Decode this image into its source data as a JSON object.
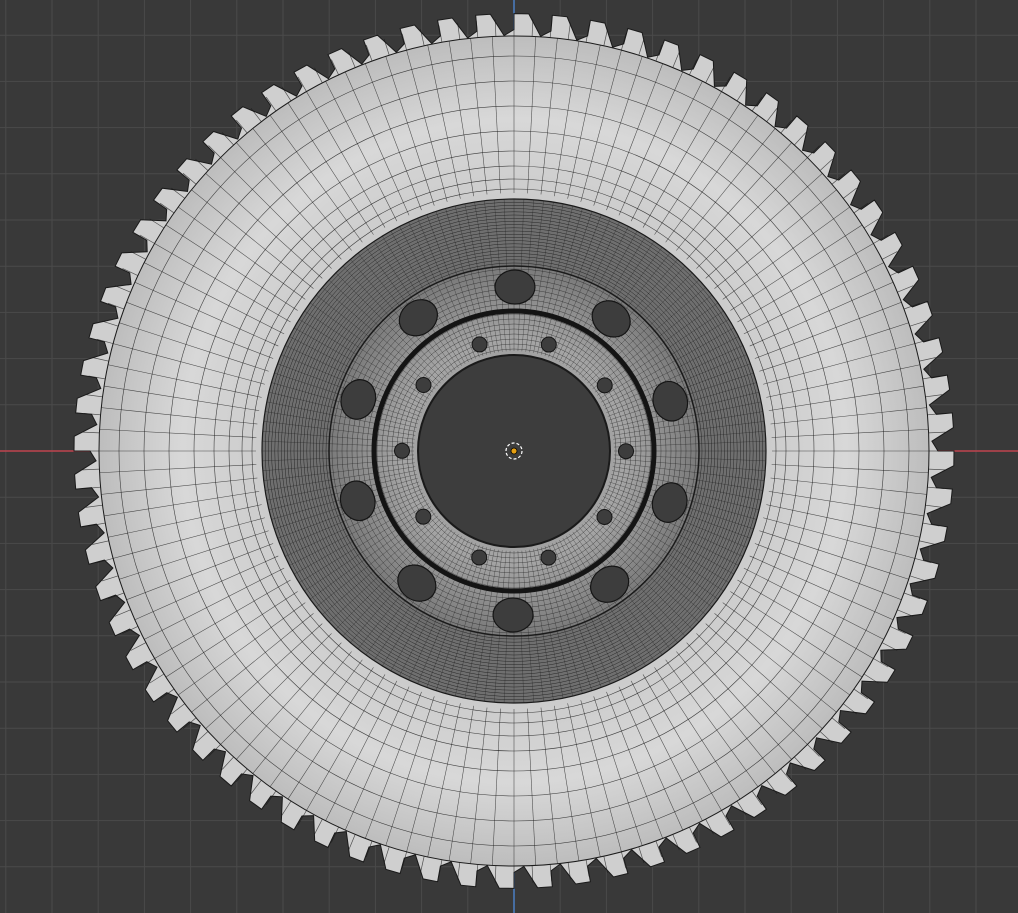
{
  "app": {
    "type": "3d-viewport",
    "view": "orthographic-front",
    "shading": "solid-with-wireframe-overlay"
  },
  "colors": {
    "background": "#393939",
    "grid_minor": "#404040",
    "grid_major": "#4a4a4a",
    "axis_x": "#c0444f",
    "axis_z": "#4a7fc4",
    "mesh_light": "#d6d6d6",
    "mesh_mid": "#a8a8a8",
    "wire": "#1a1a1a",
    "hole": "#3d3d3d",
    "origin": "#e6a012"
  },
  "scene": {
    "object": "wheel",
    "tread_blocks": 72,
    "rim_large_holes": 10,
    "rim_small_holes": 10
  },
  "viewport": {
    "grid_icon": "grid-floor",
    "origin_icon": "object-origin-icon"
  }
}
